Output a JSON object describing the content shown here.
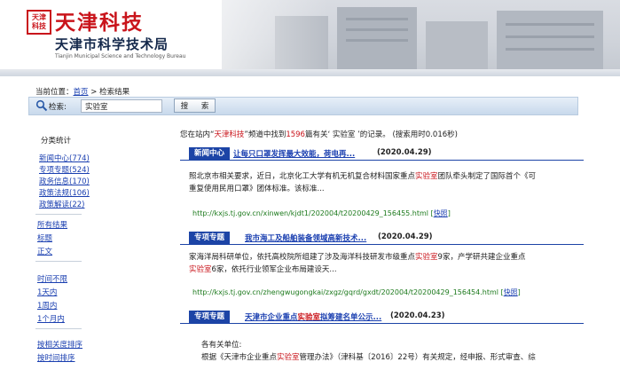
{
  "banner": {
    "seal_text": "天津\n科技",
    "title_cn": "天津科技",
    "subtitle_cn": "天津市科学技术局",
    "subtitle_en": "Tianjin Municipal Science and Technology Bureau"
  },
  "breadcrumb": {
    "prefix": "当前位置：",
    "home": "首页",
    "sep": " > ",
    "current": "检索结果"
  },
  "search": {
    "label": "检索:",
    "value": "实验室",
    "button": "搜 索"
  },
  "sidebar": {
    "stats_title": "分类统计",
    "categories": [
      {
        "label": "新闻中心",
        "count": "(774)"
      },
      {
        "label": "专项专题",
        "count": "(524)"
      },
      {
        "label": "政务信息",
        "count": "(170)"
      },
      {
        "label": "政策法规",
        "count": "(106)"
      },
      {
        "label": "政策解读",
        "count": "(22)"
      }
    ],
    "all_results": "所有结果",
    "title_only": "标题",
    "body_only": "正文",
    "time_unlimited": "时间不限",
    "time_options": [
      "1天内",
      "1周内",
      "1个月内"
    ],
    "sort_relevance": "按相关度排序",
    "sort_time": "按时间排序"
  },
  "summary": {
    "p1": "您在站内“",
    "site": "天津科技",
    "p2": "”频道中找到",
    "count": "1596",
    "p3": "篇有关‘ 实验室 ’的记录。  (搜索用时0.016秒)"
  },
  "results": [
    {
      "tag": "新闻中心",
      "title": "让每只口罩发挥最大效能，荷电再...",
      "date": "(2020.04.29)",
      "body_lines": [
        [
          "照北京市相关要求，近日，北京化工大学有机无机复合材料国家重点",
          "实验室",
          "团队牵头制定了国际首个《可"
        ],
        [
          "重复使用民用口罩》团体标准。该标准...",
          "",
          ""
        ]
      ],
      "url": "http://kxjs.tj.gov.cn/xinwen/kjdt1/202004/t20200429_156455.html",
      "snapshot": "快照"
    },
    {
      "tag": "专项专题",
      "title": "我市海工及船舶装备领域高新技术...",
      "date": "(2020.04.29)",
      "body_lines": [
        [
          "家海洋局科研单位，依托高校院所组建了涉及海洋科技研发市级重点",
          "实验室",
          "9家，产学研共建企业重点"
        ],
        [
          "实验室",
          "6家，依托行业领军企业布局建设天...",
          ""
        ]
      ],
      "url": "http://kxjs.tj.gov.cn/zhengwugongkai/zxgz/gqrd/gxdt/202004/t20200429_156454.html",
      "snapshot": "快照"
    },
    {
      "tag": "专项专题",
      "title_pre": "天津市企业重点",
      "title_hl": "实验室",
      "title_post": "拟筹建名单公示...",
      "date": "(2020.04.23)",
      "body_lines": [
        [
          "各有关单位:",
          "",
          ""
        ],
        [
          "根据《天津市企业重点",
          "实验室",
          "管理办法》（津科基〔2016〕22号）有关规定，经申报、形式审查、综"
        ]
      ]
    }
  ],
  "colors": {
    "brand_red": "#c9141b",
    "nav_blue": "#1c44a6",
    "link_blue": "#1a3fb0",
    "url_green": "#1d7a1d"
  }
}
